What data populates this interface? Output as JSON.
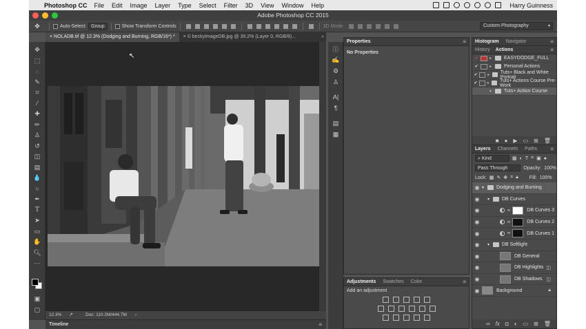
{
  "menubar": {
    "apple": "",
    "app_name": "Photoshop CC",
    "menus": [
      "File",
      "Edit",
      "Image",
      "Layer",
      "Type",
      "Select",
      "Filter",
      "3D",
      "View",
      "Window",
      "Help"
    ],
    "user": "Harry Guinness"
  },
  "window": {
    "title": "Adobe Photoshop CC 2015"
  },
  "options": {
    "auto_select_label": "Auto-Select:",
    "auto_select_value": "Group",
    "transform_label": "Show Transform Controls",
    "mode_3d": "3D Mode:",
    "workspace": "Custom Photography"
  },
  "document_tabs": [
    {
      "label": "NOLADB.tif @ 12.3% (Dodging and Burning, RGB/16*) *"
    },
    {
      "label": "© beckyImageDB.jpg @ 39.2% (Layer 0, RGB/8)..."
    }
  ],
  "status": {
    "zoom": "12.3%",
    "doc": "Doc: 110.2M/444.7M"
  },
  "timeline_label": "Timeline",
  "properties": {
    "title": "Properties",
    "empty": "No Properties"
  },
  "adjustments": {
    "tabs": [
      "Adjustments",
      "Swatches",
      "Color"
    ],
    "hint": "Add an adjustment"
  },
  "history": {
    "tabs": [
      "Histogram",
      "Navigator"
    ],
    "subtabs": [
      "History",
      "Actions"
    ],
    "actions": [
      {
        "label": "EASYDODGE_FULL",
        "checked": true,
        "expanded": false
      },
      {
        "label": "Personal Actions",
        "checked": true,
        "expanded": false
      },
      {
        "label": "Tuts+ Black and White Portrait",
        "checked": true,
        "expanded": false
      },
      {
        "label": "Tuts+ Actions Course Pre-Work",
        "checked": true,
        "expanded": false
      },
      {
        "label": "Tuts+ Action Course",
        "checked": false,
        "expanded": true
      }
    ]
  },
  "layers": {
    "tabs": [
      "Layers",
      "Channels",
      "Paths"
    ],
    "kind": "Kind",
    "blend_mode": "Pass Through",
    "opacity_label": "Opacity:",
    "opacity": "100%",
    "lock_label": "Lock:",
    "fill_label": "Fill:",
    "fill": "100%",
    "items": [
      {
        "name": "Dodging and Burning",
        "type": "group",
        "indent": 0
      },
      {
        "name": "DB Curves",
        "type": "group",
        "indent": 1
      },
      {
        "name": "DB Curves 3",
        "type": "adjust",
        "indent": 2,
        "thumb": "#ffffff"
      },
      {
        "name": "DB Curves 2",
        "type": "adjust",
        "indent": 2,
        "thumb": "#111111"
      },
      {
        "name": "DB Curves 1",
        "type": "adjust",
        "indent": 2,
        "thumb": "#111111"
      },
      {
        "name": "DB Softlight",
        "type": "group",
        "indent": 1
      },
      {
        "name": "DB General",
        "type": "layer",
        "indent": 2,
        "thumb": "#777777"
      },
      {
        "name": "DB Highlights",
        "type": "layer",
        "indent": 2,
        "thumb": "#777777"
      },
      {
        "name": "DB Shadows",
        "type": "layer",
        "indent": 2,
        "thumb": "#777777"
      },
      {
        "name": "Background",
        "type": "layer",
        "indent": 0,
        "thumb": "#888888"
      }
    ]
  },
  "colors": {
    "ui_bg": "#535353",
    "panel": "#4a4a4a",
    "canvas": "#282828",
    "red": "#ff5f57",
    "yellow": "#febc2e",
    "green": "#28c840"
  }
}
